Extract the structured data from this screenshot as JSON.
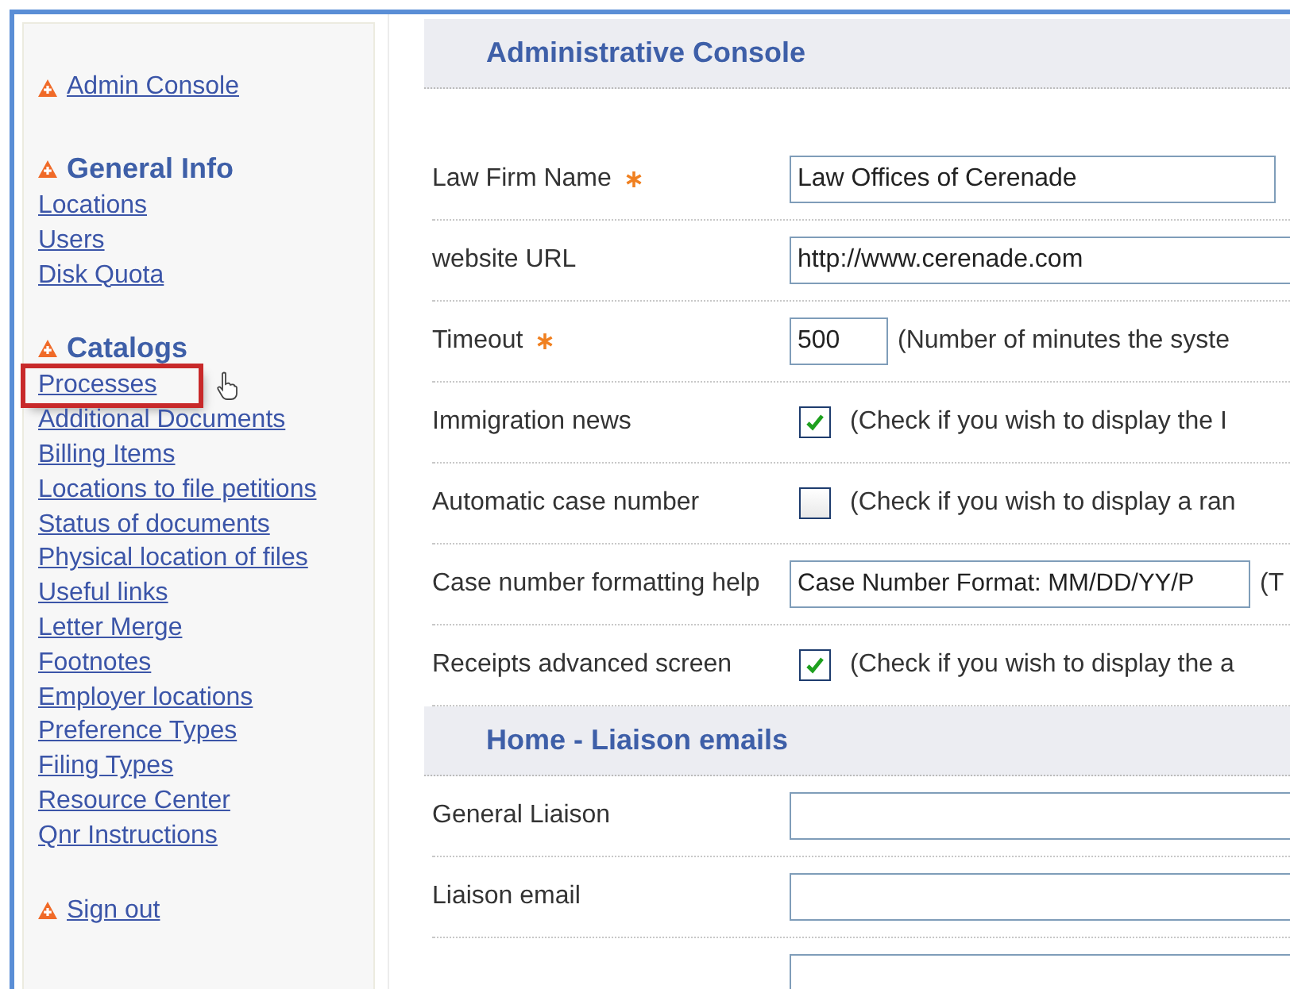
{
  "sidebar": {
    "sections": [
      {
        "kind": "link",
        "title": "Admin Console"
      },
      {
        "kind": "group",
        "title": "General Info",
        "items": [
          {
            "label": "Locations",
            "highlighted": false
          },
          {
            "label": "Users",
            "highlighted": false
          },
          {
            "label": "Disk Quota",
            "highlighted": false
          }
        ]
      },
      {
        "kind": "group",
        "title": "Catalogs",
        "items": [
          {
            "label": "Processes",
            "highlighted": true
          },
          {
            "label": "Additional Documents",
            "highlighted": false
          },
          {
            "label": "Billing Items",
            "highlighted": false
          },
          {
            "label": "Locations to file petitions",
            "highlighted": false
          },
          {
            "label": "Status of documents",
            "highlighted": false
          },
          {
            "label": "Physical location of files",
            "highlighted": false
          },
          {
            "label": "Useful links",
            "highlighted": false
          },
          {
            "label": "Letter Merge",
            "highlighted": false
          },
          {
            "label": "Footnotes",
            "highlighted": false
          },
          {
            "label": "Employer locations",
            "highlighted": false
          },
          {
            "label": "Preference Types",
            "highlighted": false
          },
          {
            "label": "Filing Types",
            "highlighted": false
          },
          {
            "label": "Resource Center",
            "highlighted": false
          },
          {
            "label": "Qnr Instructions",
            "highlighted": false
          }
        ]
      },
      {
        "kind": "link",
        "title": "Sign out"
      }
    ]
  },
  "sections": [
    {
      "title": "Administrative Console",
      "rows": [
        {
          "kind": "input",
          "label": "Law Firm Name",
          "required": true,
          "value": "Law Offices of Cerenade"
        },
        {
          "kind": "wide-input",
          "label": "website URL",
          "required": false,
          "value": "http://www.cerenade.com"
        },
        {
          "kind": "short-input",
          "label": "Timeout",
          "required": true,
          "value": "500",
          "note": "(Number of minutes the syste"
        },
        {
          "kind": "checkbox",
          "label": "Immigration news",
          "checked": true,
          "note": "(Check if you wish to display the I"
        },
        {
          "kind": "checkbox",
          "label": "Automatic case number",
          "checked": false,
          "note": "(Check if you wish to display a ran"
        },
        {
          "kind": "medium-input",
          "label": "Case number formatting help",
          "required": false,
          "value": "Case Number Format: MM/DD/YY/P",
          "note": "(T"
        },
        {
          "kind": "checkbox",
          "label": "Receipts advanced screen",
          "checked": true,
          "note": "(Check if you wish to display the a"
        }
      ]
    },
    {
      "title": "Home - Liaison emails",
      "rows": [
        {
          "kind": "wide-input",
          "label": "General Liaison",
          "required": false
        },
        {
          "kind": "wide-input",
          "label": "Liaison email",
          "required": false
        },
        {
          "kind": "wide-input",
          "required": false
        }
      ]
    }
  ]
}
